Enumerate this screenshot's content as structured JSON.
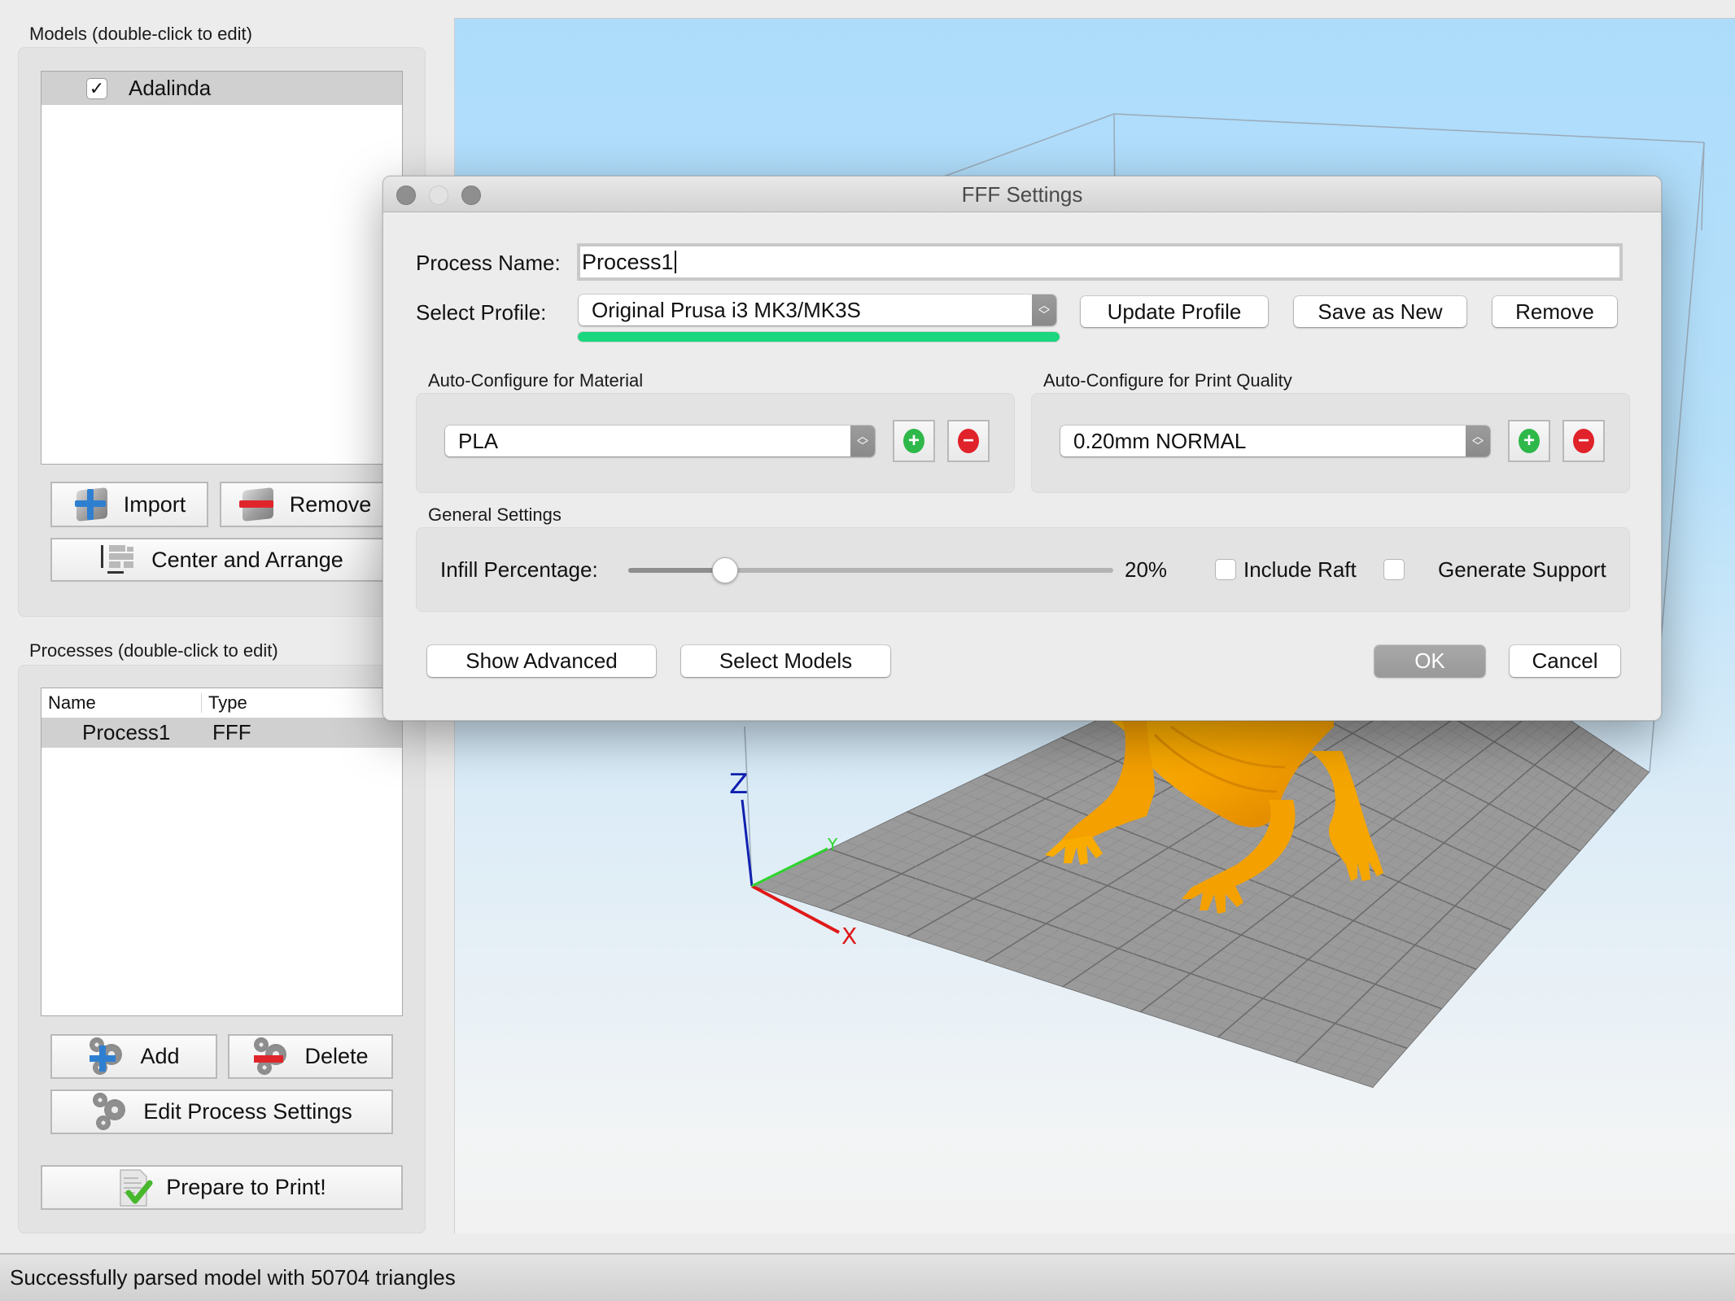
{
  "models_panel": {
    "label": "Models (double-click to edit)",
    "items": [
      {
        "name": "Adalinda",
        "checked": true
      }
    ],
    "buttons": {
      "import": "Import",
      "remove": "Remove",
      "center_arrange": "Center and Arrange"
    }
  },
  "processes_panel": {
    "label": "Processes (double-click to edit)",
    "columns": [
      "Name",
      "Type"
    ],
    "rows": [
      {
        "name": "Process1",
        "type": "FFF"
      }
    ],
    "buttons": {
      "add": "Add",
      "delete": "Delete",
      "edit": "Edit Process Settings",
      "prepare": "Prepare to Print!"
    }
  },
  "status_bar": {
    "message": "Successfully parsed model with 50704 triangles"
  },
  "viewport": {
    "axes": {
      "x": "X",
      "y": "Y",
      "z": "Z"
    },
    "colors": {
      "x_axis": "#e01818",
      "y_axis": "#2fd52f",
      "z_axis": "#1020b0",
      "bed": "#9a9a9a",
      "model": "#f7a600"
    }
  },
  "dialog": {
    "title": "FFF Settings",
    "process_name_label": "Process Name:",
    "process_name_value": "Process1",
    "select_profile_label": "Select Profile:",
    "profile_value": "Original Prusa i3 MK3/MK3S",
    "profile_progress": 1.0,
    "buttons": {
      "update_profile": "Update Profile",
      "save_as_new": "Save as New",
      "remove": "Remove",
      "show_advanced": "Show Advanced",
      "select_models": "Select Models",
      "ok": "OK",
      "cancel": "Cancel"
    },
    "material_group": {
      "title": "Auto-Configure for Material",
      "value": "PLA"
    },
    "quality_group": {
      "title": "Auto-Configure for Print Quality",
      "value": "0.20mm NORMAL"
    },
    "general_group": {
      "title": "General Settings",
      "infill_label": "Infill Percentage:",
      "infill_value_text": "20%",
      "infill_percent": 20,
      "include_raft_label": "Include Raft",
      "include_raft": false,
      "generate_support_label": "Generate Support",
      "generate_support": false
    },
    "colors": {
      "progress": "#1bd67f",
      "add_icon": "#2eb84a",
      "remove_icon": "#e0222a"
    }
  }
}
